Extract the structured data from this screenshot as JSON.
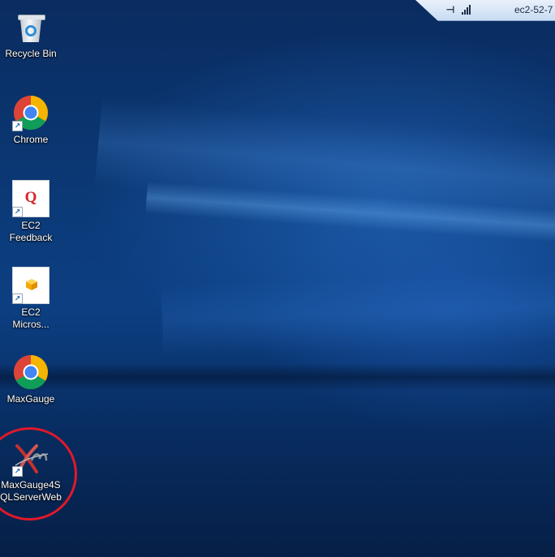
{
  "connection_bar": {
    "title": "ec2-52-7"
  },
  "desktop": {
    "icons": [
      {
        "label": "Recycle Bin",
        "icon": "recycle-bin-icon",
        "shortcut": false
      },
      {
        "label": "Chrome",
        "icon": "chrome-icon",
        "shortcut": true
      },
      {
        "label": "EC2\nFeedback",
        "icon": "ec2-feedback-icon",
        "shortcut": true
      },
      {
        "label": "EC2\nMicros...",
        "icon": "ec2-microsoft-icon",
        "shortcut": true
      },
      {
        "label": "MaxGauge",
        "icon": "chrome-icon",
        "shortcut": false
      },
      {
        "label": "MaxGauge4S\nQLServerWeb",
        "icon": "maxgauge-xm-icon",
        "shortcut": true
      }
    ]
  },
  "colors": {
    "wallpaper": "#0b3a78",
    "highlight": "#e0192a",
    "label_text": "#ffffff"
  }
}
